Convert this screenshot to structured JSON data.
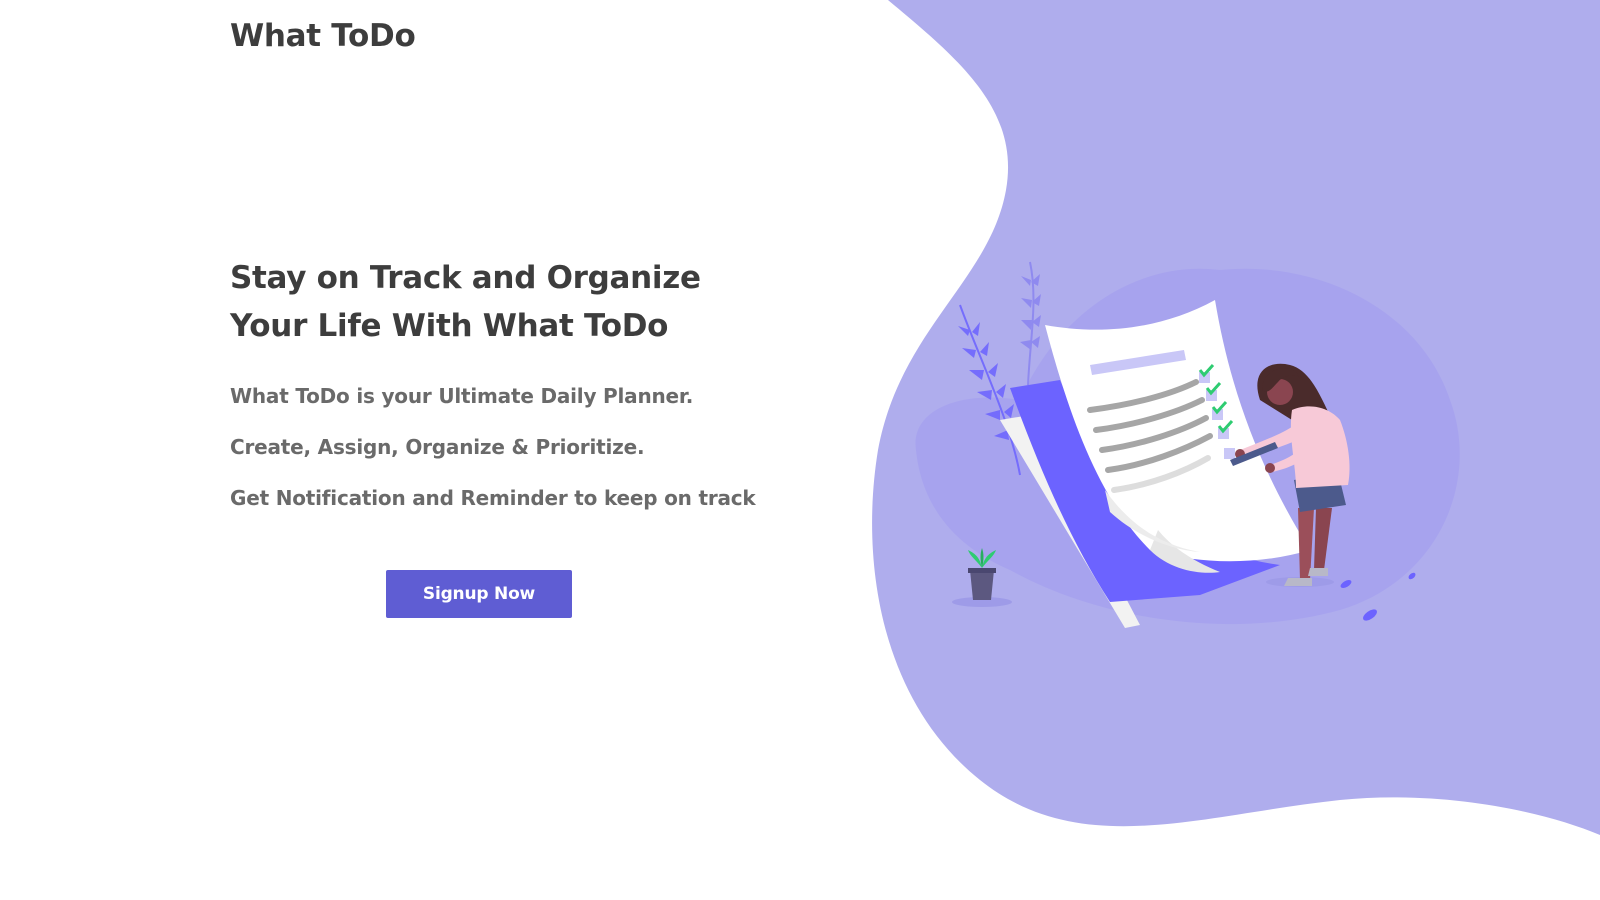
{
  "header": {
    "logo_text": "What ToDo"
  },
  "hero": {
    "title_line1": "Stay on Track and Organize",
    "title_line2": "Your Life With What ToDo",
    "taglines": [
      "What ToDo is your Ultimate Daily Planner.",
      "Create, Assign, Organize & Prioritize.",
      "Get Notification and Reminder to keep on track"
    ],
    "cta_label": "Signup Now"
  },
  "illustration": {
    "icon": "woman-checking-todo-list-illustration",
    "checked_items": 4,
    "total_items": 5
  },
  "colors": {
    "accent": "#5f5dd3",
    "blob": "#afaded",
    "blob_inner": "#a7a3ee",
    "paper_accent": "#6c63ff",
    "check": "#2ecc71",
    "heading_text": "#3d3d3d",
    "body_text": "#6a6a6a"
  }
}
